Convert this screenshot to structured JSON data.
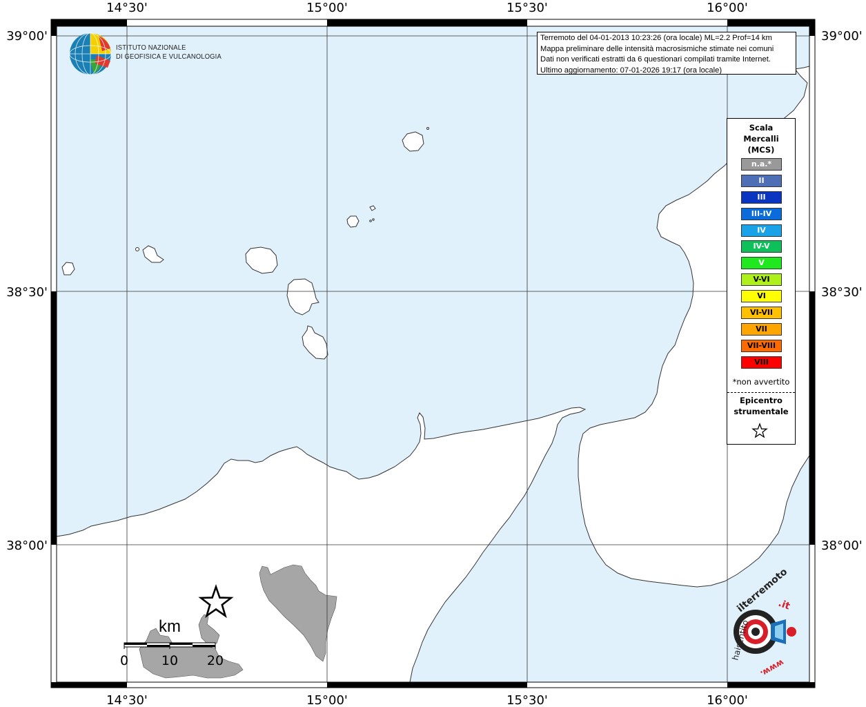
{
  "map": {
    "lon_ticks": [
      {
        "lon": 14.5,
        "label": "14°30'"
      },
      {
        "lon": 15.0,
        "label": "15°00'"
      },
      {
        "lon": 15.5,
        "label": "15°30'"
      },
      {
        "lon": 16.0,
        "label": "16°00'"
      }
    ],
    "lat_ticks": [
      {
        "lat": 39.0,
        "label": "39°00'"
      },
      {
        "lat": 38.5,
        "label": "38°30'"
      },
      {
        "lat": 38.0,
        "label": "38°00'"
      }
    ],
    "colors": {
      "sea": "#e0f1fb",
      "land": "#ffffff",
      "felt": "#a6a6a6",
      "coast": "#333333"
    }
  },
  "info": {
    "line1": "Terremoto del 04-01-2013 10:23:26 (ora locale) ML=2.2 Prof=14 km",
    "line2": "Mappa preliminare delle intensità macrosismiche stimate nei comuni",
    "line3": "Dati non verificati estratti da 6 questionari compilati tramite Internet.",
    "line4": "Ultimo aggiornamento: 07-01-2026 19:17 (ora locale)"
  },
  "legend": {
    "title_1": "Scala",
    "title_2": "Mercalli",
    "title_3": "(MCS)",
    "items": [
      {
        "label": "n.a.*",
        "color": "#999999"
      },
      {
        "label": "II",
        "color": "#4e6fb6"
      },
      {
        "label": "III",
        "color": "#0a35c0"
      },
      {
        "label": "III-IV",
        "color": "#0a6cdb"
      },
      {
        "label": "IV",
        "color": "#1aa2e8"
      },
      {
        "label": "IV-V",
        "color": "#0ec05a"
      },
      {
        "label": "V",
        "color": "#1fe81f"
      },
      {
        "label": "V-VI",
        "color": "#aef019"
      },
      {
        "label": "VI",
        "color": "#ffff00"
      },
      {
        "label": "VI-VII",
        "color": "#ffc000"
      },
      {
        "label": "VII",
        "color": "#ffa500"
      },
      {
        "label": "VII-VIII",
        "color": "#ff6a00"
      },
      {
        "label": "VIII",
        "color": "#ff0000"
      }
    ],
    "note": "*non avvertito",
    "epicentre_1": "Epicentro",
    "epicentre_2": "strumentale"
  },
  "scale_bar": {
    "unit": "km",
    "labels": [
      "0",
      "10",
      "20"
    ]
  },
  "logos": {
    "ingv_line1": "ISTITUTO NAZIONALE",
    "ingv_line2": "DI GEOFISICA E VULCANOLOGIA",
    "hs_text_1": "haisentito",
    "hs_text_2": "ilterremoto",
    "hs_text_3": ".it",
    "hs_text_4": "www."
  }
}
